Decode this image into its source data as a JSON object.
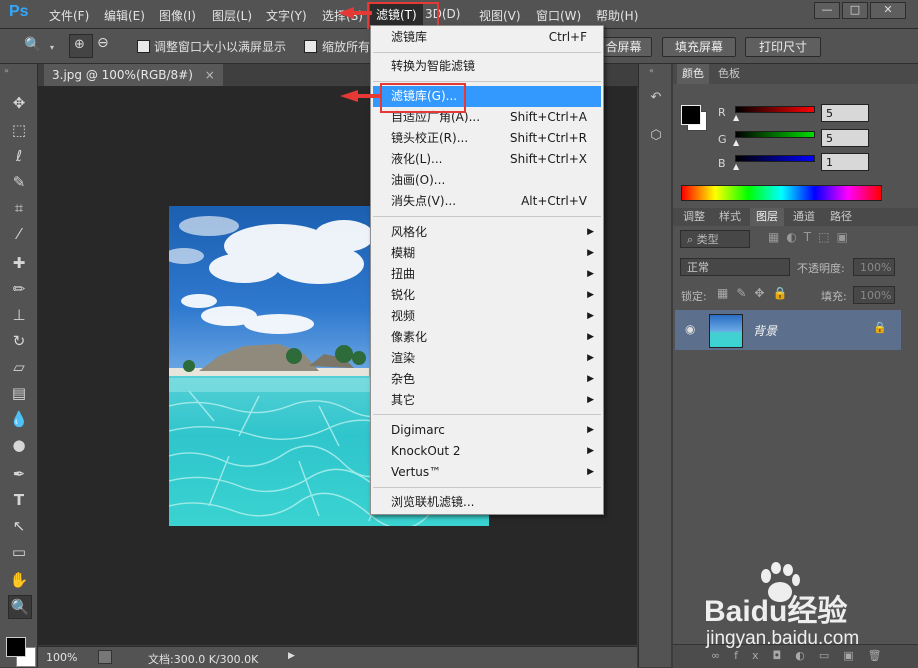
{
  "app": {
    "logo": "Ps"
  },
  "menubar": {
    "items": [
      "文件(F)",
      "编辑(E)",
      "图像(I)",
      "图层(L)",
      "文字(Y)",
      "选择(S)",
      "滤镜(T)",
      "3D(D)",
      "视图(V)",
      "窗口(W)",
      "帮助(H)"
    ],
    "window_buttons": [
      "—",
      "□",
      "✕"
    ]
  },
  "options": {
    "resize_windows": "调整窗口大小以满屏显示",
    "zoom_all": "缩放所有",
    "fit_screen": "合屏幕",
    "fill_screen": "填充屏幕",
    "print_size": "打印尺寸"
  },
  "document": {
    "tab_label": "3.jpg @ 100%(RGB/8#)",
    "tab_close": "×",
    "zoom": "100%",
    "doc_size": "文档:300.0 K/300.0K"
  },
  "filter_menu": {
    "items": [
      {
        "label": "滤镜库",
        "shortcut": "Ctrl+F"
      },
      {
        "label": "转换为智能滤镜",
        "shortcut": ""
      },
      {
        "label": "滤镜库(G)...",
        "shortcut": ""
      },
      {
        "label": "自适应广角(A)...",
        "shortcut": "Shift+Ctrl+A"
      },
      {
        "label": "镜头校正(R)...",
        "shortcut": "Shift+Ctrl+R"
      },
      {
        "label": "液化(L)...",
        "shortcut": "Shift+Ctrl+X"
      },
      {
        "label": "油画(O)...",
        "shortcut": ""
      },
      {
        "label": "消失点(V)...",
        "shortcut": "Alt+Ctrl+V"
      },
      {
        "label": "风格化",
        "shortcut": ""
      },
      {
        "label": "模糊",
        "shortcut": ""
      },
      {
        "label": "扭曲",
        "shortcut": ""
      },
      {
        "label": "锐化",
        "shortcut": ""
      },
      {
        "label": "视频",
        "shortcut": ""
      },
      {
        "label": "像素化",
        "shortcut": ""
      },
      {
        "label": "渲染",
        "shortcut": ""
      },
      {
        "label": "杂色",
        "shortcut": ""
      },
      {
        "label": "其它",
        "shortcut": ""
      },
      {
        "label": "Digimarc",
        "shortcut": ""
      },
      {
        "label": "KnockOut 2",
        "shortcut": ""
      },
      {
        "label": "Vertus™",
        "shortcut": ""
      },
      {
        "label": "浏览联机滤镜...",
        "shortcut": ""
      }
    ],
    "highlight_color": "#3399ff",
    "annotation_color": "#e53935"
  },
  "color_panel": {
    "tabs": [
      "颜色",
      "色板"
    ],
    "channels": [
      {
        "name": "R",
        "value": "5"
      },
      {
        "name": "G",
        "value": "5"
      },
      {
        "name": "B",
        "value": "1"
      }
    ]
  },
  "layers_panel": {
    "tabs": [
      "调整",
      "样式",
      "图层",
      "通道",
      "路径"
    ],
    "filter_kind": "类型",
    "blend_mode": "正常",
    "opacity_label": "不透明度:",
    "opacity_value": "100%",
    "lock_label": "锁定:",
    "fill_label": "填充:",
    "fill_value": "100%",
    "layer_name": "背景"
  },
  "watermark": {
    "brand": "Baidu经验",
    "url": "jingyan.baidu.com"
  }
}
